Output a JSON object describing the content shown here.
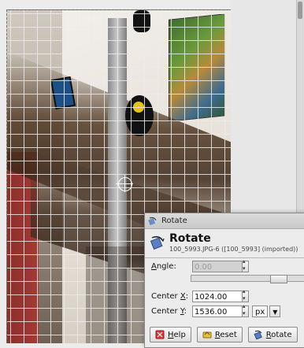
{
  "dialog": {
    "window_title": "Rotate",
    "header_title": "Rotate",
    "header_subtitle": "100_5993.JPG-6 ([100_5993] (imported))",
    "angle": {
      "label_prefix": "",
      "label_accel": "A",
      "label_rest": "ngle:",
      "value": "0.00"
    },
    "center_x": {
      "label_prefix": "Center ",
      "label_accel": "X",
      "label_rest": ":",
      "value": "1024.00"
    },
    "center_y": {
      "label_prefix": "Center ",
      "label_accel": "Y",
      "label_rest": ":",
      "value": "1536.00"
    },
    "unit": {
      "selected": "px"
    },
    "buttons": {
      "help": {
        "accel": "H",
        "rest": "elp"
      },
      "reset": {
        "accel": "R",
        "rest": "eset"
      },
      "rotate": {
        "accel": "R",
        "rest": "otate"
      }
    }
  },
  "icons": {
    "title": "rotate-tool-icon",
    "header": "rotate-tool-icon",
    "help": "help-icon",
    "reset": "reset-icon",
    "rotate": "rotate-tool-icon"
  }
}
